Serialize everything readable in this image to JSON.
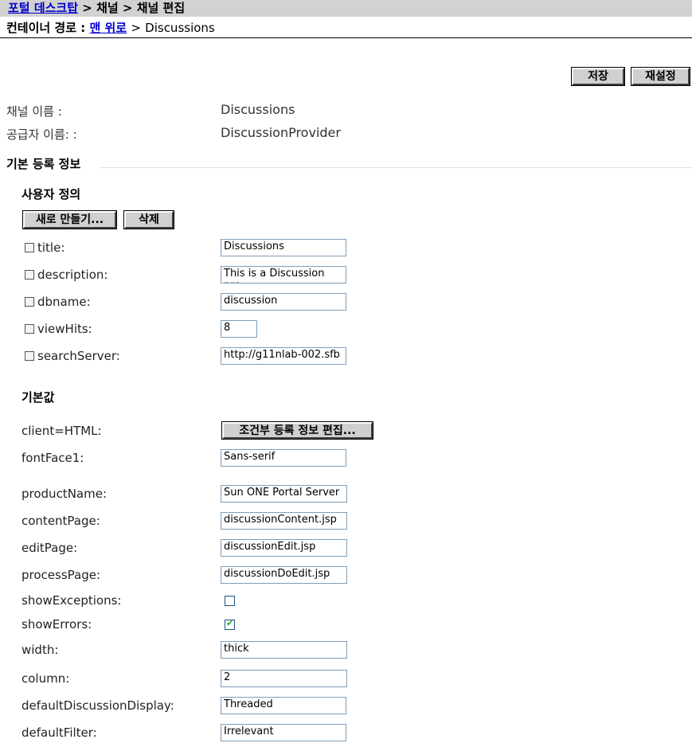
{
  "breadcrumb": {
    "link": "포털 데스크탑",
    "sep1": ">",
    "item1": "채널",
    "sep2": ">",
    "item2": "채널 편집"
  },
  "container_path": {
    "label": "컨테이너 경로 :",
    "link": "맨 위로",
    "sep": ">",
    "current": "Discussions"
  },
  "toolbar": {
    "save": "저장",
    "reset": "재설정"
  },
  "channel": {
    "name_label": "채널 이름 :",
    "name_value": "Discussions",
    "provider_label": "공급자 이름: :",
    "provider_value": "DiscussionProvider"
  },
  "section_title": "기본 등록 정보",
  "user_defined": {
    "title": "사용자 정의",
    "new_button": "새로 만들기...",
    "delete_button": "삭제",
    "rows": [
      {
        "label": "title:",
        "value": "Discussions"
      },
      {
        "label": "description:",
        "value": "This is a Discussion pro"
      },
      {
        "label": "dbname:",
        "value": "discussion"
      },
      {
        "label": "viewHits:",
        "value": "8"
      },
      {
        "label": "searchServer:",
        "value": "http://g11nlab-002.sfb"
      }
    ]
  },
  "defaults": {
    "title": "기본값",
    "client_label": "client=HTML:",
    "client_button": "조건부 등록 정보 편집...",
    "fields": [
      {
        "label": "fontFace1:",
        "value": "Sans-serif"
      },
      {
        "label": "productName:",
        "value": "Sun ONE Portal Server"
      },
      {
        "label": "contentPage:",
        "value": "discussionContent.jsp"
      },
      {
        "label": "editPage:",
        "value": "discussionEdit.jsp"
      },
      {
        "label": "processPage:",
        "value": "discussionDoEdit.jsp"
      }
    ],
    "show_exceptions": {
      "label": "showExceptions:",
      "checked": false
    },
    "show_errors": {
      "label": "showErrors:",
      "checked": true
    },
    "fields2": [
      {
        "label": "width:",
        "value": "thick"
      },
      {
        "label": "column:",
        "value": "2"
      },
      {
        "label": "defaultDiscussionDisplay:",
        "value": "Threaded"
      },
      {
        "label": "defaultFilter:",
        "value": "Irrelevant"
      }
    ]
  }
}
